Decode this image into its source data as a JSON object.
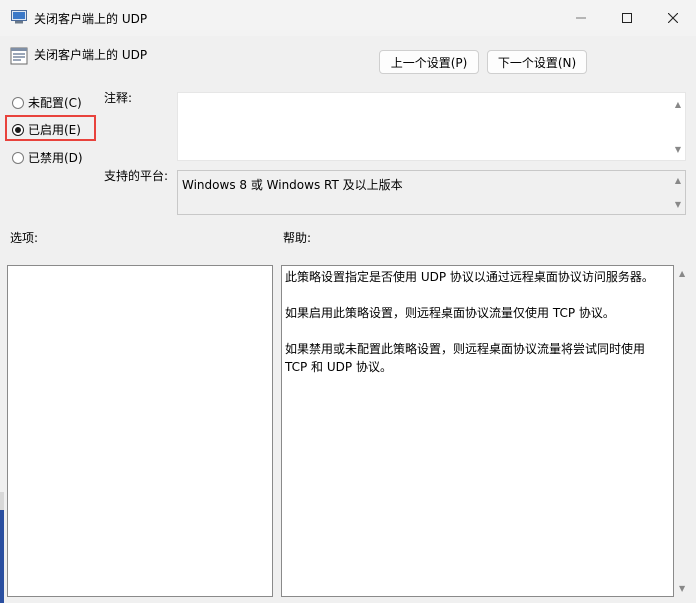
{
  "window": {
    "title": "关闭客户端上的 UDP"
  },
  "header": {
    "policy_name": "关闭客户端上的 UDP"
  },
  "nav": {
    "prev_label": "上一个设置(P)",
    "next_label": "下一个设置(N)"
  },
  "state": {
    "options": [
      {
        "label": "未配置(C)",
        "checked": false
      },
      {
        "label": "已启用(E)",
        "checked": true
      },
      {
        "label": "已禁用(D)",
        "checked": false
      }
    ]
  },
  "comment": {
    "label": "注释:",
    "value": ""
  },
  "platform": {
    "label": "支持的平台:",
    "value": "Windows 8 或 Windows RT 及以上版本"
  },
  "options_section": {
    "label": "选项:"
  },
  "help_section": {
    "label": "帮助:",
    "paragraphs": [
      "此策略设置指定是否使用 UDP 协议以通过远程桌面协议访问服务器。",
      "如果启用此策略设置，则远程桌面协议流量仅使用 TCP 协议。",
      "如果禁用或未配置此策略设置，则远程桌面协议流量将尝试同时使用 TCP 和 UDP 协议。"
    ]
  },
  "colors": {
    "highlight": "#e8423c"
  }
}
